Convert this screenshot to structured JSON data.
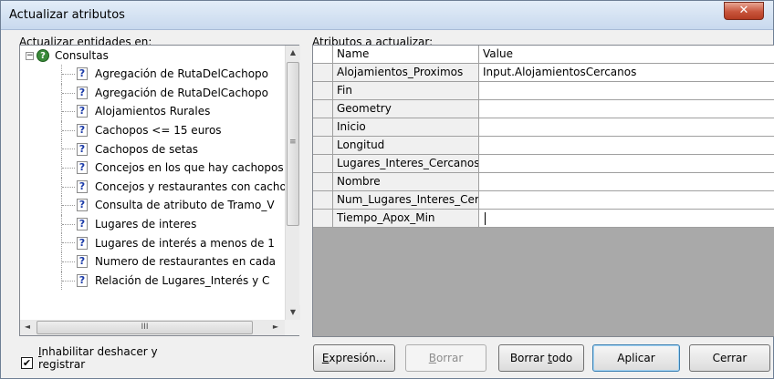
{
  "window": {
    "title": "Actualizar atributos",
    "close_glyph": "✕"
  },
  "left": {
    "label_accel": "A",
    "label_rest": "ctualizar entidades en:",
    "root": {
      "label": "Consultas",
      "expander": "−",
      "icon": "?"
    },
    "items": [
      "Agregación de RutaDelCachopo",
      "Agregación de RutaDelCachopo",
      "Alojamientos Rurales",
      "Cachopos <= 15 euros",
      "Cachopos de setas",
      "Concejos en los que hay cachopos",
      "Concejos y restaurantes con cachopos",
      "Consulta de atributo de Tramo_V",
      "Lugares de interes",
      "Lugares de interés a menos de 1",
      "Numero de restaurantes en cada",
      "Relación de Lugares_Interés y C"
    ],
    "item_icon": "?",
    "vscroll": {
      "up": "▲",
      "down": "▼",
      "grip": "≡"
    },
    "hscroll": {
      "left": "◄",
      "right": "►",
      "grip": "III"
    }
  },
  "right": {
    "label_accel": "A",
    "label_rest": "tributos a actualizar:",
    "columns": {
      "name": "Name",
      "value": "Value"
    },
    "rows": [
      {
        "name": "Alojamientos_Proximos",
        "value": "Input.AlojamientosCercanos"
      },
      {
        "name": "Fin",
        "value": ""
      },
      {
        "name": "Geometry",
        "value": ""
      },
      {
        "name": "Inicio",
        "value": ""
      },
      {
        "name": "Longitud",
        "value": ""
      },
      {
        "name": "Lugares_Interes_Cercanos",
        "value": ""
      },
      {
        "name": "Nombre",
        "value": ""
      },
      {
        "name": "Num_Lugares_Interes_Cercanos",
        "value": ""
      },
      {
        "name": "Tiempo_Apox_Min",
        "value": ""
      }
    ]
  },
  "footer": {
    "checkbox": {
      "checked": true,
      "mark": "✔",
      "line1_accel": "I",
      "line1_rest": "nhabilitar deshacer y",
      "line2": "registrar"
    },
    "buttons": {
      "expresion": {
        "accel": "E",
        "rest": "xpresión..."
      },
      "borrar": {
        "accel": "B",
        "rest": "orrar"
      },
      "borrar_todo": {
        "pre": "Borrar ",
        "accel": "t",
        "rest": "odo"
      },
      "aplicar": "Aplicar",
      "cerrar": "Cerrar"
    }
  }
}
